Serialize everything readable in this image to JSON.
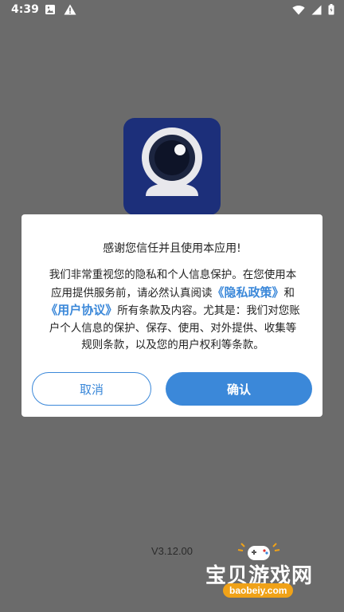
{
  "status_bar": {
    "time": "4:39",
    "left_icons": [
      "image-notification-icon",
      "warning-icon"
    ],
    "right_icons": [
      "wifi-icon",
      "signal-icon",
      "battery-icon"
    ]
  },
  "app": {
    "logo_icon": "webcam-icon",
    "version": "V3.12.00"
  },
  "dialog": {
    "title": "感谢您信任并且使用本应用!",
    "body_part1": "我们非常重视您的隐私和个人信息保护。在您使用本应用提供服务前，请必然认真阅读",
    "privacy_link": "《隐私政策》",
    "and_text": "和",
    "agreement_link": "《用户协议》",
    "body_part2": "所有条款及内容。尤其是：我们对您账户个人信息的保护、保存、使用、对外提供、收集等规则条款，以及您的用户权利等条款。",
    "cancel_label": "取消",
    "confirm_label": "确认"
  },
  "watermark": {
    "cn_text": "宝贝游戏网",
    "url_text": "baobeiy.com"
  },
  "colors": {
    "overlay": "#6b6b6b",
    "accent": "#3b88d9",
    "logo_bg": "#1c2f7a"
  }
}
